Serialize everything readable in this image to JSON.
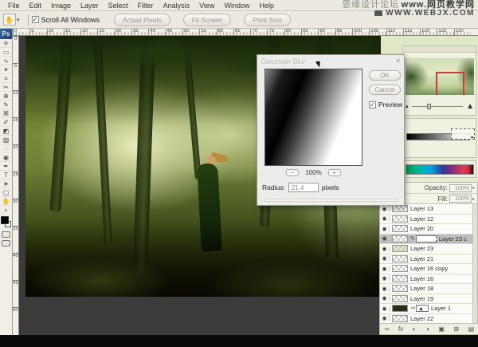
{
  "branding": {
    "line1_gray": "思缘设计论坛",
    "line1_dark": "www.网页教学网",
    "line2": "WWW.WEBJX.COM"
  },
  "menubar": {
    "items": [
      "File",
      "Edit",
      "Image",
      "Layer",
      "Select",
      "Filter",
      "Analysis",
      "View",
      "Window",
      "Help"
    ]
  },
  "options_bar": {
    "tool_glyph": "✋",
    "dropdown_glyph": "▾",
    "check_glyph": "✓",
    "scroll_all_windows": "Scroll All Windows",
    "buttons": [
      "Actual Pixels",
      "Fit Screen",
      "Print Size"
    ]
  },
  "toolbox": {
    "logo": "Ps",
    "tools": [
      {
        "name": "move-tool",
        "glyph": "✛"
      },
      {
        "name": "marquee-tool",
        "glyph": "▭"
      },
      {
        "name": "lasso-tool",
        "glyph": "∿"
      },
      {
        "name": "magic-wand-tool",
        "glyph": "✦"
      },
      {
        "name": "crop-tool",
        "glyph": "⌗"
      },
      {
        "name": "slice-tool",
        "glyph": "✂"
      },
      {
        "name": "healing-brush-tool",
        "glyph": "⊕"
      },
      {
        "name": "brush-tool",
        "glyph": "✎"
      },
      {
        "name": "clone-stamp-tool",
        "glyph": "⌘"
      },
      {
        "name": "history-brush-tool",
        "glyph": "✐"
      },
      {
        "name": "eraser-tool",
        "glyph": "◩"
      },
      {
        "name": "gradient-tool",
        "glyph": "▨"
      },
      {
        "name": "blur-tool",
        "glyph": "◌"
      },
      {
        "name": "dodge-tool",
        "glyph": "◉"
      },
      {
        "name": "pen-tool",
        "glyph": "✒"
      },
      {
        "name": "type-tool",
        "glyph": "T"
      },
      {
        "name": "path-select-tool",
        "glyph": "➤"
      },
      {
        "name": "shape-tool",
        "glyph": "▢"
      },
      {
        "name": "hand-tool",
        "glyph": "✋"
      },
      {
        "name": "zoom-tool",
        "glyph": "⌕"
      }
    ]
  },
  "rulers": {
    "h_labels": [
      "0",
      "5",
      "10",
      "15",
      "20",
      "25",
      "30",
      "35",
      "40",
      "45",
      "50",
      "55",
      "60",
      "65",
      "70",
      "75",
      "80",
      "85",
      "90",
      "95",
      "100",
      "105",
      "110",
      "115",
      "120",
      "125",
      "130"
    ],
    "v_labels": [
      "0",
      "5",
      "10",
      "15",
      "20",
      "25",
      "30",
      "35",
      "40",
      "45",
      "50"
    ]
  },
  "dialog": {
    "title": "Gaussian Blur",
    "close_glyph": "✕",
    "ok": "OK",
    "cancel": "Cancel",
    "preview": "Preview",
    "check_glyph": "✓",
    "zoom_out": "−",
    "zoom_value": "100%",
    "zoom_in": "+",
    "radius_label": "Radius:",
    "radius_value": "21.4",
    "radius_unit": "pixels"
  },
  "navigator": {
    "zoom_small_glyph": "▴",
    "zoom_large_glyph": "▲",
    "arrow_glyph": "▸"
  },
  "layers_panel": {
    "opacity_label": "Opacity:",
    "opacity_value": "100%",
    "fill_label": "Fill:",
    "fill_value": "100%",
    "dd_glyph": "▸",
    "eye_glyph": "◉",
    "brush_glyph": "✎",
    "link_glyph": "∞",
    "mask_mark": "▲",
    "lock_icons": [
      {
        "name": "lock-transparency-icon",
        "glyph": "◫"
      },
      {
        "name": "lock-position-icon",
        "glyph": "✛"
      },
      {
        "name": "lock-all-icon",
        "glyph": "▪"
      }
    ],
    "layers": [
      {
        "name": "Layer 13"
      },
      {
        "name": "Layer 12"
      },
      {
        "name": "Layer 20"
      },
      {
        "name": "Layer 23 c",
        "selected": true,
        "editing": true
      },
      {
        "name": "Layer 23",
        "tint": true
      },
      {
        "name": "Layer 21"
      },
      {
        "name": "Layer 16 copy"
      },
      {
        "name": "Layer 16"
      },
      {
        "name": "Layer 18"
      },
      {
        "name": "Layer 19"
      },
      {
        "name": "Layer 1",
        "mask": true
      },
      {
        "name": "Layer 22"
      }
    ],
    "bottom_icons": [
      {
        "name": "link-layers-icon",
        "glyph": "∞"
      },
      {
        "name": "layer-style-icon",
        "glyph": "fx"
      },
      {
        "name": "layer-mask-icon",
        "glyph": "◐"
      },
      {
        "name": "adjustment-layer-icon",
        "glyph": "◑"
      },
      {
        "name": "new-group-icon",
        "glyph": "▣"
      },
      {
        "name": "new-layer-icon",
        "glyph": "⊞"
      },
      {
        "name": "delete-layer-icon",
        "glyph": "▤"
      }
    ]
  }
}
